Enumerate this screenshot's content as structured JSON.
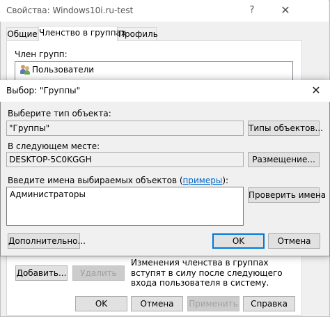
{
  "back_window": {
    "title": "Свойства: Windows10i.ru-test",
    "help_glyph": "?",
    "close_glyph": "✕",
    "tabs": [
      {
        "label": "Общие",
        "active": false
      },
      {
        "label": "Членство в группах",
        "active": true
      },
      {
        "label": "Профиль",
        "active": false
      }
    ],
    "members_label": "Член групп:",
    "members": [
      "Пользователи"
    ],
    "add_button": "Добавить...",
    "remove_button": "Удалить",
    "note": "Изменения членства в группах вступят в силу после следующего входа пользователя в систему.",
    "ok_button": "OK",
    "cancel_button": "Отмена",
    "apply_button": "Применить",
    "help_button": "Справка"
  },
  "dialog": {
    "title": "Выбор: \"Группы\"",
    "close_glyph": "✕",
    "object_type_label": "Выберите тип объекта:",
    "object_type_value": "\"Группы\"",
    "object_types_button": "Типы объектов...",
    "location_label": "В следующем месте:",
    "location_value": "DESKTOP-5C0KGGH",
    "locations_button": "Размещение...",
    "names_label_prefix": "Введите имена выбираемых объектов (",
    "names_label_link": "примеры",
    "names_label_suffix": "):",
    "names_value": "Администраторы",
    "check_names_button": "Проверить имена",
    "advanced_button": "Дополнительно...",
    "ok_button": "OK",
    "cancel_button": "Отмена"
  },
  "colors": {
    "window_bg": "#f0f0f0",
    "accent": "#0078d7",
    "link": "#0066cc"
  }
}
